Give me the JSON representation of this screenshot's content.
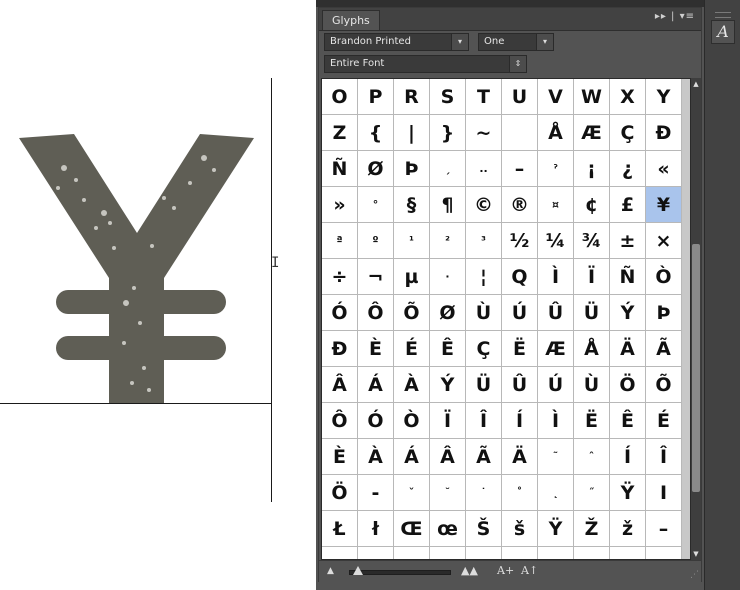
{
  "panel": {
    "tab_label": "Glyphs",
    "tab_controls": "▸▸ | ▾≡",
    "font_family": "Brandon Printed",
    "font_style": "One",
    "show_filter": "Entire Font"
  },
  "canvas": {
    "glyph_preview": "¥",
    "glyph_color": "#5f5e55"
  },
  "glyph_grid": {
    "selected": "¥",
    "selected_color": "#a9c4ec",
    "rows": [
      [
        "O",
        "P",
        "R",
        "S",
        "T",
        "U",
        "V",
        "W",
        "X",
        "Y"
      ],
      [
        "Z",
        "{",
        "|",
        "}",
        "~",
        "",
        "Å",
        "Æ",
        "Ç",
        "Đ"
      ],
      [
        "Ñ",
        "Ø",
        "Þ",
        "ˏ",
        "..",
        "–",
        "ˀ",
        "¡",
        "¿",
        "«"
      ],
      [
        "»",
        "°",
        "§",
        "¶",
        "©",
        "®",
        "¤",
        "¢",
        "£",
        "¥"
      ],
      [
        "ª",
        "º",
        "¹",
        "²",
        "³",
        "½",
        "¼",
        "¾",
        "±",
        "×"
      ],
      [
        "÷",
        "¬",
        "µ",
        "·",
        "¦",
        "Q",
        "Ì",
        "Ï",
        "Ñ",
        "Ò"
      ],
      [
        "Ó",
        "Ô",
        "Õ",
        "Ø",
        "Ù",
        "Ú",
        "Û",
        "Ü",
        "Ý",
        "Þ"
      ],
      [
        "Đ",
        "È",
        "É",
        "Ê",
        "Ç",
        "Ë",
        "Æ",
        "Å",
        "Ä",
        "Ã"
      ],
      [
        "Â",
        "Á",
        "À",
        "Ý",
        "Ü",
        "Û",
        "Ú",
        "Ù",
        "Ö",
        "Õ"
      ],
      [
        "Ô",
        "Ó",
        "Ò",
        "Ï",
        "Î",
        "Í",
        "Ì",
        "Ë",
        "Ê",
        "É"
      ],
      [
        "È",
        "À",
        "Á",
        "Â",
        "Ã",
        "Ä",
        "˜",
        "ˆ",
        "Í",
        "Î"
      ],
      [
        "Ö",
        "-",
        "ˇ",
        "˘",
        "˙",
        "˚",
        "˛",
        "˝",
        "Ÿ",
        "I"
      ],
      [
        "Ł",
        "ł",
        "Œ",
        "œ",
        "Š",
        "š",
        "Ÿ",
        "Ž",
        "ž",
        "–"
      ],
      [
        "",
        "",
        "",
        "",
        "",
        "",
        "",
        "",
        "",
        ""
      ]
    ]
  },
  "bottom_bar": {
    "zoom_out_icon": "mountain-small-icon",
    "zoom_in_icon": "mountain-large-icon",
    "increase_size_label": "A+",
    "decrease_size_label": "A↑"
  },
  "dock": {
    "glyphs_button_label": "A"
  }
}
